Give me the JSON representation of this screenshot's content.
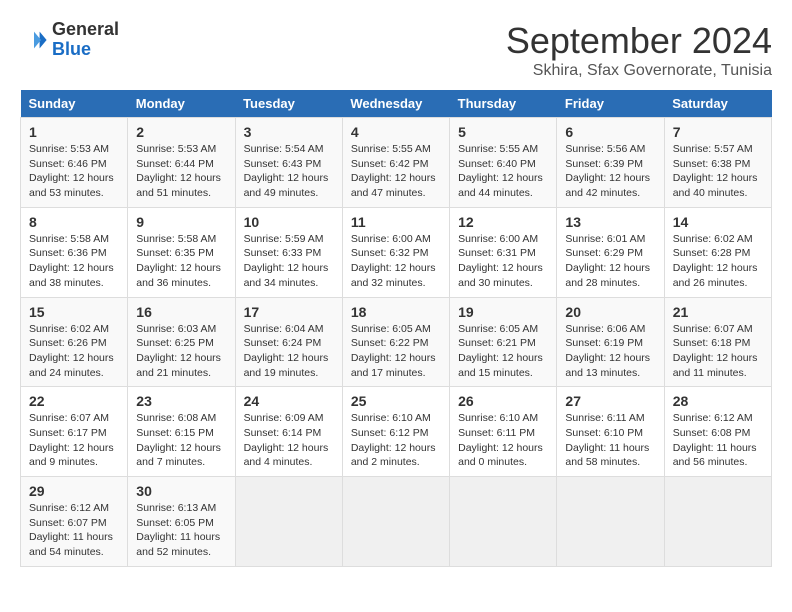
{
  "header": {
    "logo_line1": "General",
    "logo_line2": "Blue",
    "title": "September 2024",
    "subtitle": "Skhira, Sfax Governorate, Tunisia"
  },
  "calendar": {
    "days_of_week": [
      "Sunday",
      "Monday",
      "Tuesday",
      "Wednesday",
      "Thursday",
      "Friday",
      "Saturday"
    ],
    "weeks": [
      [
        {
          "day": "",
          "info": ""
        },
        {
          "day": "2",
          "info": "Sunrise: 5:53 AM\nSunset: 6:44 PM\nDaylight: 12 hours and 51 minutes."
        },
        {
          "day": "3",
          "info": "Sunrise: 5:54 AM\nSunset: 6:43 PM\nDaylight: 12 hours and 49 minutes."
        },
        {
          "day": "4",
          "info": "Sunrise: 5:55 AM\nSunset: 6:42 PM\nDaylight: 12 hours and 47 minutes."
        },
        {
          "day": "5",
          "info": "Sunrise: 5:55 AM\nSunset: 6:40 PM\nDaylight: 12 hours and 44 minutes."
        },
        {
          "day": "6",
          "info": "Sunrise: 5:56 AM\nSunset: 6:39 PM\nDaylight: 12 hours and 42 minutes."
        },
        {
          "day": "7",
          "info": "Sunrise: 5:57 AM\nSunset: 6:38 PM\nDaylight: 12 hours and 40 minutes."
        }
      ],
      [
        {
          "day": "1",
          "info": "Sunrise: 5:53 AM\nSunset: 6:46 PM\nDaylight: 12 hours and 53 minutes."
        },
        {
          "day": "9",
          "info": "Sunrise: 5:58 AM\nSunset: 6:35 PM\nDaylight: 12 hours and 36 minutes."
        },
        {
          "day": "10",
          "info": "Sunrise: 5:59 AM\nSunset: 6:33 PM\nDaylight: 12 hours and 34 minutes."
        },
        {
          "day": "11",
          "info": "Sunrise: 6:00 AM\nSunset: 6:32 PM\nDaylight: 12 hours and 32 minutes."
        },
        {
          "day": "12",
          "info": "Sunrise: 6:00 AM\nSunset: 6:31 PM\nDaylight: 12 hours and 30 minutes."
        },
        {
          "day": "13",
          "info": "Sunrise: 6:01 AM\nSunset: 6:29 PM\nDaylight: 12 hours and 28 minutes."
        },
        {
          "day": "14",
          "info": "Sunrise: 6:02 AM\nSunset: 6:28 PM\nDaylight: 12 hours and 26 minutes."
        }
      ],
      [
        {
          "day": "8",
          "info": "Sunrise: 5:58 AM\nSunset: 6:36 PM\nDaylight: 12 hours and 38 minutes."
        },
        {
          "day": "16",
          "info": "Sunrise: 6:03 AM\nSunset: 6:25 PM\nDaylight: 12 hours and 21 minutes."
        },
        {
          "day": "17",
          "info": "Sunrise: 6:04 AM\nSunset: 6:24 PM\nDaylight: 12 hours and 19 minutes."
        },
        {
          "day": "18",
          "info": "Sunrise: 6:05 AM\nSunset: 6:22 PM\nDaylight: 12 hours and 17 minutes."
        },
        {
          "day": "19",
          "info": "Sunrise: 6:05 AM\nSunset: 6:21 PM\nDaylight: 12 hours and 15 minutes."
        },
        {
          "day": "20",
          "info": "Sunrise: 6:06 AM\nSunset: 6:19 PM\nDaylight: 12 hours and 13 minutes."
        },
        {
          "day": "21",
          "info": "Sunrise: 6:07 AM\nSunset: 6:18 PM\nDaylight: 12 hours and 11 minutes."
        }
      ],
      [
        {
          "day": "15",
          "info": "Sunrise: 6:02 AM\nSunset: 6:26 PM\nDaylight: 12 hours and 24 minutes."
        },
        {
          "day": "23",
          "info": "Sunrise: 6:08 AM\nSunset: 6:15 PM\nDaylight: 12 hours and 7 minutes."
        },
        {
          "day": "24",
          "info": "Sunrise: 6:09 AM\nSunset: 6:14 PM\nDaylight: 12 hours and 4 minutes."
        },
        {
          "day": "25",
          "info": "Sunrise: 6:10 AM\nSunset: 6:12 PM\nDaylight: 12 hours and 2 minutes."
        },
        {
          "day": "26",
          "info": "Sunrise: 6:10 AM\nSunset: 6:11 PM\nDaylight: 12 hours and 0 minutes."
        },
        {
          "day": "27",
          "info": "Sunrise: 6:11 AM\nSunset: 6:10 PM\nDaylight: 11 hours and 58 minutes."
        },
        {
          "day": "28",
          "info": "Sunrise: 6:12 AM\nSunset: 6:08 PM\nDaylight: 11 hours and 56 minutes."
        }
      ],
      [
        {
          "day": "22",
          "info": "Sunrise: 6:07 AM\nSunset: 6:17 PM\nDaylight: 12 hours and 9 minutes."
        },
        {
          "day": "30",
          "info": "Sunrise: 6:13 AM\nSunset: 6:05 PM\nDaylight: 11 hours and 52 minutes."
        },
        {
          "day": "",
          "info": ""
        },
        {
          "day": "",
          "info": ""
        },
        {
          "day": "",
          "info": ""
        },
        {
          "day": "",
          "info": ""
        },
        {
          "day": "",
          "info": ""
        }
      ],
      [
        {
          "day": "29",
          "info": "Sunrise: 6:12 AM\nSunset: 6:07 PM\nDaylight: 11 hours and 54 minutes."
        },
        {
          "day": "",
          "info": ""
        },
        {
          "day": "",
          "info": ""
        },
        {
          "day": "",
          "info": ""
        },
        {
          "day": "",
          "info": ""
        },
        {
          "day": "",
          "info": ""
        },
        {
          "day": "",
          "info": ""
        }
      ]
    ]
  }
}
